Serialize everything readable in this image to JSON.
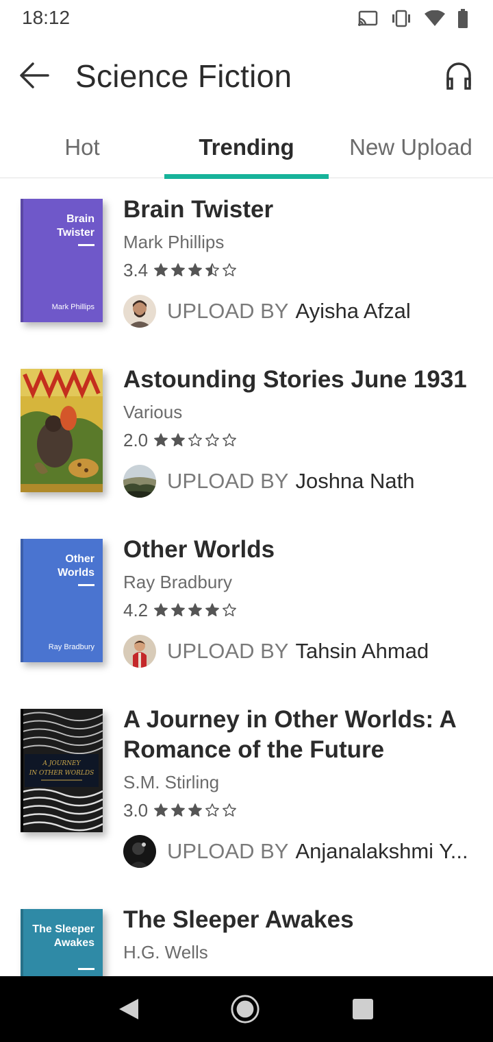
{
  "status_bar": {
    "time": "18:12",
    "icons": [
      "cast-icon",
      "vibrate-icon",
      "wifi-icon",
      "battery-icon"
    ]
  },
  "app_bar": {
    "title": "Science Fiction",
    "back_icon": "arrow-left-icon",
    "action_icon": "headphones-icon"
  },
  "tabs": [
    {
      "label": "Hot",
      "active": false
    },
    {
      "label": "Trending",
      "active": true
    },
    {
      "label": "New Upload",
      "active": false
    }
  ],
  "colors": {
    "accent": "#17b39a",
    "cover_purple": "#6f58c9",
    "cover_blue": "#4a74d0",
    "cover_teal": "#2f8aa6"
  },
  "upload_label": "UPLOAD BY",
  "books": [
    {
      "title": "Brain Twister",
      "author": "Mark  Phillips",
      "rating": "3.4",
      "stars": 3.5,
      "uploader": "Ayisha Afzal",
      "cover": {
        "style": "plain",
        "color": "#6f58c9",
        "title": "Brain Twister",
        "author": "Mark  Phillips"
      }
    },
    {
      "title": "Astounding Stories June 1931",
      "author": "Various",
      "rating": "2.0",
      "stars": 2,
      "uploader": "Joshna Nath",
      "cover": {
        "style": "illustrated",
        "color": "#c9a227",
        "title": "",
        "author": ""
      }
    },
    {
      "title": "Other Worlds",
      "author": "Ray Bradbury",
      "rating": "4.2",
      "stars": 4,
      "uploader": "Tahsin Ahmad",
      "cover": {
        "style": "plain",
        "color": "#4a74d0",
        "title": "Other Worlds",
        "author": "Ray Bradbury"
      }
    },
    {
      "title": "A Journey in Other Worlds: A Romance of the Future",
      "author": "S.M. Stirling",
      "rating": "3.0",
      "stars": 3,
      "uploader": "Anjanalakshmi Y...",
      "cover": {
        "style": "pattern",
        "color": "#2a2a2a",
        "title": "A JOURNEY IN OTHER WORLDS",
        "author": ""
      }
    },
    {
      "title": "The Sleeper Awakes",
      "author": "H.G. Wells",
      "rating": "",
      "stars": 0,
      "uploader": "",
      "cover": {
        "style": "plain",
        "color": "#2f8aa6",
        "title": "The Sleeper Awakes",
        "author": ""
      }
    }
  ],
  "nav_bar": {
    "icons": [
      "back-triangle-icon",
      "home-circle-icon",
      "recents-square-icon"
    ]
  }
}
